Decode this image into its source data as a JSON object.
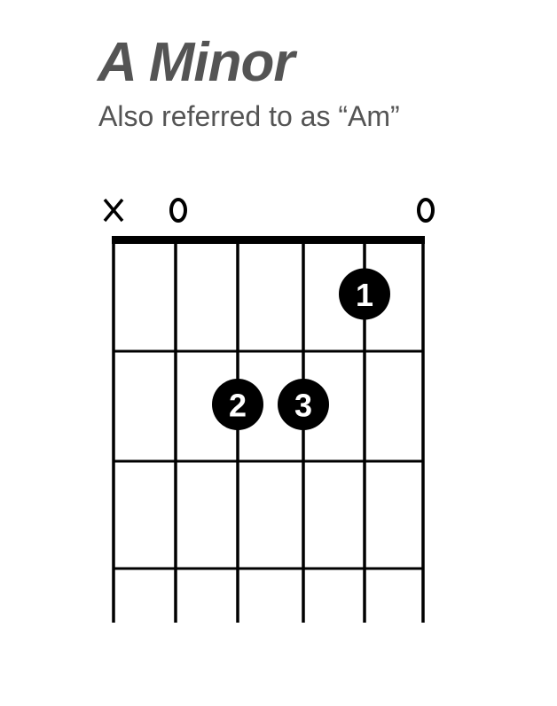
{
  "title": "A Minor",
  "subtitle": "Also referred to as “Am”",
  "chord_diagram": {
    "string_markers": [
      "X",
      "O",
      "",
      "",
      "",
      "O"
    ],
    "fingers": [
      {
        "string": 5,
        "fret": 1,
        "label": "1"
      },
      {
        "string": 3,
        "fret": 2,
        "label": "2"
      },
      {
        "string": 4,
        "fret": 2,
        "label": "3"
      }
    ],
    "frets_shown": 4,
    "colors": {
      "lines": "#000000",
      "dot_fill": "#000000",
      "dot_text": "#ffffff",
      "title": "#545454"
    }
  }
}
